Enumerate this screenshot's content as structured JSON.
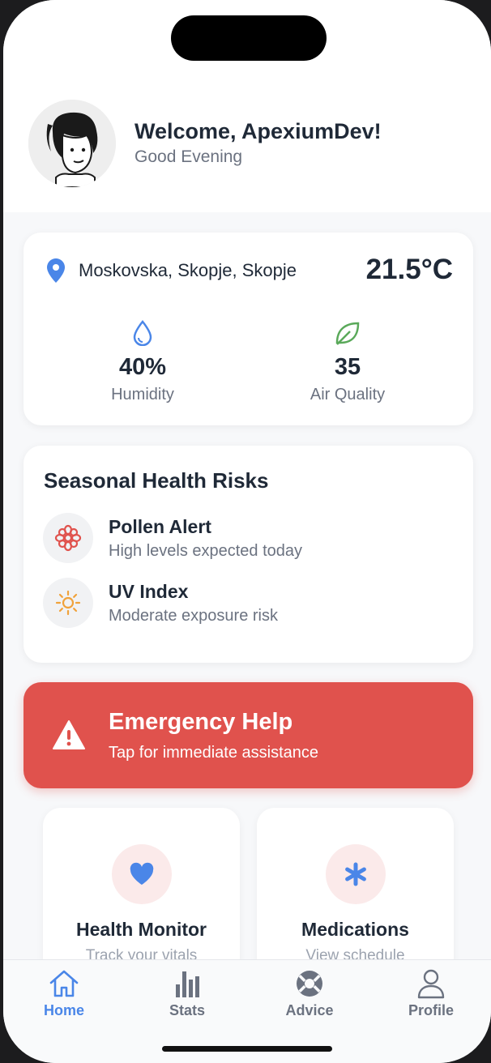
{
  "header": {
    "welcome": "Welcome, ApexiumDev!",
    "greeting": "Good Evening",
    "avatar_icon": "user-avatar-illustration"
  },
  "weather": {
    "location": "Moskovska, Skopje, Skopje",
    "temperature": "21.5°C",
    "humidity_value": "40%",
    "humidity_label": "Humidity",
    "air_quality_value": "35",
    "air_quality_label": "Air Quality"
  },
  "risks": {
    "title": "Seasonal Health Risks",
    "items": [
      {
        "title": "Pollen Alert",
        "description": "High levels expected today",
        "icon": "flower-icon",
        "color": "#e0524d"
      },
      {
        "title": "UV Index",
        "description": "Moderate exposure risk",
        "icon": "sun-icon",
        "color": "#f0a23b"
      }
    ]
  },
  "emergency": {
    "title": "Emergency Help",
    "subtitle": "Tap for immediate assistance",
    "color": "#e0524d"
  },
  "tiles": [
    {
      "title": "Health Monitor",
      "subtitle": "Track your vitals",
      "icon": "heart-icon"
    },
    {
      "title": "Medications",
      "subtitle": "View schedule",
      "icon": "asterisk-icon"
    }
  ],
  "tabs": [
    {
      "label": "Home",
      "icon": "home-icon",
      "active": true
    },
    {
      "label": "Stats",
      "icon": "bar-chart-icon",
      "active": false
    },
    {
      "label": "Advice",
      "icon": "lifebuoy-icon",
      "active": false
    },
    {
      "label": "Profile",
      "icon": "person-icon",
      "active": false
    }
  ],
  "colors": {
    "accent": "#4a86e8",
    "danger": "#e0524d",
    "leaf": "#5aa95a"
  }
}
